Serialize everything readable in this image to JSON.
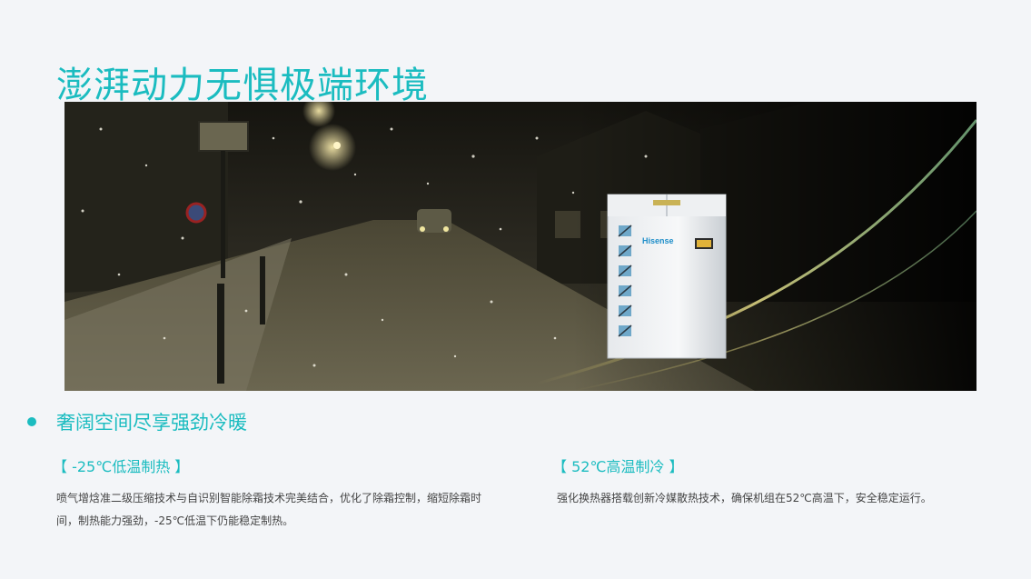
{
  "title": "澎湃动力无惧极端环境",
  "hero": {
    "brand_text": "Hisense"
  },
  "section": {
    "title": "奢阔空间尽享强劲冷暖"
  },
  "features": [
    {
      "title": "【 -25℃低温制热 】",
      "body": "喷气增焓准二级压缩技术与自识别智能除霜技术完美结合，优化了除霜控制，缩短除霜时间，制热能力强劲，-25℃低温下仍能稳定制热。"
    },
    {
      "title": "【 52℃高温制冷 】",
      "body": "强化换热器搭载创新冷媒散热技术，确保机组在52℃高温下，安全稳定运行。"
    }
  ],
  "colors": {
    "accent": "#1bbcc0",
    "body_text": "#444444",
    "background": "#f3f5f8"
  }
}
